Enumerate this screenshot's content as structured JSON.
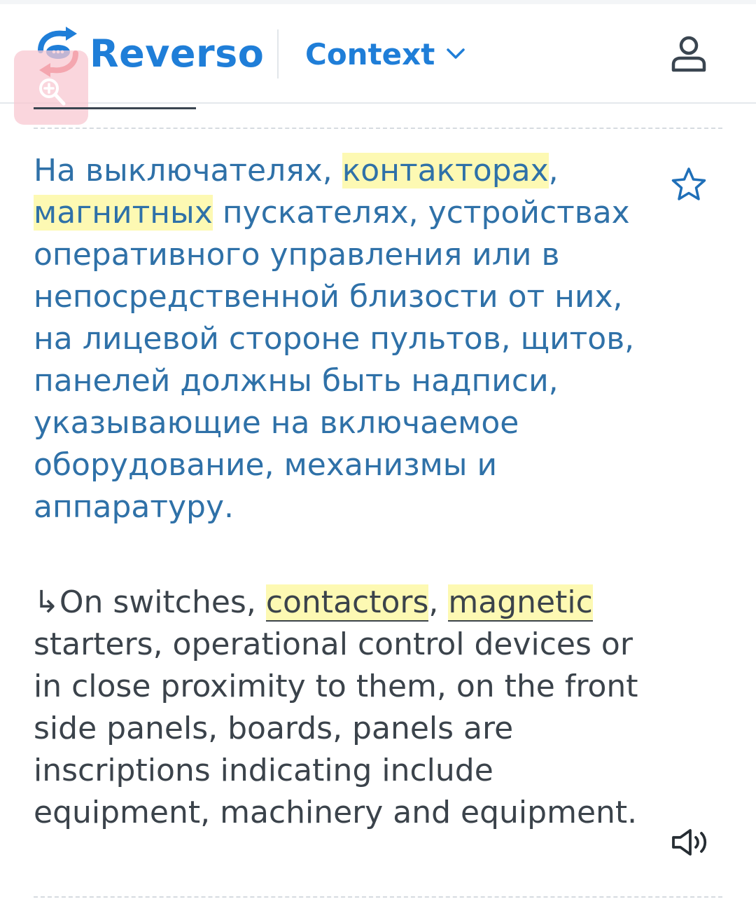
{
  "header": {
    "brand": "Reverso",
    "product_selector": "Context",
    "icons": {
      "logo": "reverso-logo-icon",
      "chevron": "chevron-down-icon",
      "account": "user-icon",
      "zoom": "zoom-in-icon"
    }
  },
  "example": {
    "source": {
      "segments": [
        {
          "text": "На выключателях, ",
          "highlight": false
        },
        {
          "text": "контакторах",
          "highlight": true
        },
        {
          "text": ", ",
          "highlight": false
        },
        {
          "text": "магнитных",
          "highlight": true
        },
        {
          "text": " пускателях, устройствах оперативного управления или в непосредственной близости от них, на лицевой стороне пультов, щитов, панелей должны быть надписи, указывающие на включаемое оборудование, механизмы и аппаратуру.",
          "highlight": false
        }
      ]
    },
    "target": {
      "arrow": "↳",
      "segments": [
        {
          "text": "On switches, ",
          "highlight": false
        },
        {
          "text": "contactors",
          "highlight": true
        },
        {
          "text": ", ",
          "highlight": false
        },
        {
          "text": "magnetic",
          "highlight": true
        },
        {
          "text": " starters, operational control devices or in close proximity to them, on the front side panels, boards, panels are inscriptions indicating include equipment, machinery and equipment.",
          "highlight": false
        }
      ]
    },
    "icons": {
      "favorite": "star-icon",
      "audio": "speaker-icon"
    }
  },
  "colors": {
    "brand_blue": "#1f7ed8",
    "source_text": "#2f71a8",
    "target_text": "#3b434b",
    "highlight": "#fdf9b3",
    "logo_red": "#e8424a"
  }
}
